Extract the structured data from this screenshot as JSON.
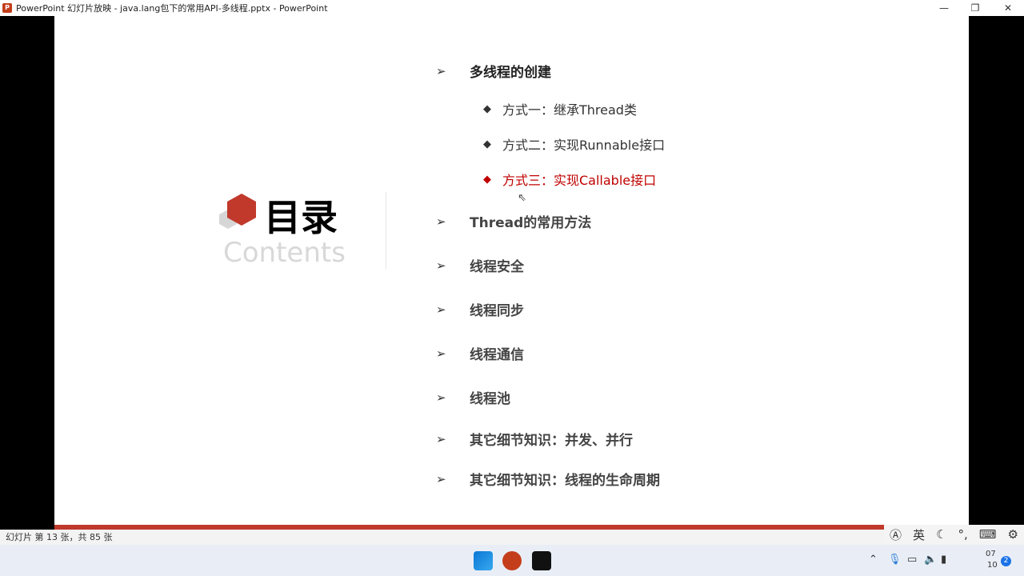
{
  "window": {
    "title": "PowerPoint 幻灯片放映  -  java.lang包下的常用API-多线程.pptx - PowerPoint",
    "minimize": "—",
    "restore": "❐",
    "close": "✕"
  },
  "slide": {
    "title": "目录",
    "subtitle": "Contents",
    "accent_color": "#c0392b",
    "items": [
      {
        "label": "多线程的创建",
        "subitems": [
          {
            "label": "方式一：继承Thread类",
            "active": false
          },
          {
            "label": "方式二：实现Runnable接口",
            "active": false
          },
          {
            "label": "方式三：实现Callable接口",
            "active": true
          }
        ]
      },
      {
        "label": "Thread的常用方法"
      },
      {
        "label": "线程安全"
      },
      {
        "label": "线程同步"
      },
      {
        "label": "线程通信"
      },
      {
        "label": "线程池"
      },
      {
        "label": "其它细节知识：并发、并行"
      },
      {
        "label": "其它细节知识：线程的生命周期"
      }
    ]
  },
  "status": {
    "slide_info": "幻灯片 第 13 张，共 85 张"
  },
  "ime": {
    "mode": "英"
  },
  "tray": {
    "time_top": "07",
    "time_bottom": "10",
    "notifications": "2"
  }
}
